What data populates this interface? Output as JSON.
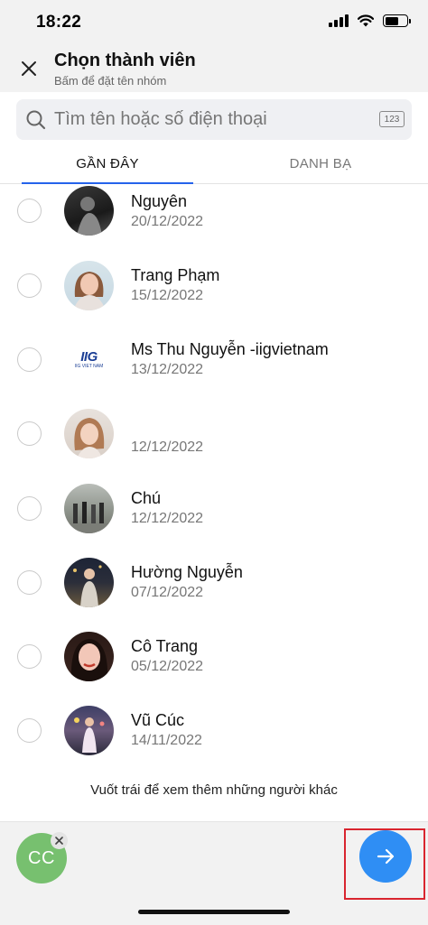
{
  "status_bar": {
    "time": "18:22",
    "icons": [
      "signal-icon",
      "wifi-icon",
      "battery-icon"
    ]
  },
  "header": {
    "close_icon": "close-icon",
    "title": "Chọn thành viên",
    "subtitle": "Bấm để đặt tên nhóm"
  },
  "search": {
    "placeholder": "Tìm tên hoặc số điện thoại",
    "value": "",
    "numpad_label": "123"
  },
  "tabs": [
    {
      "label": "GẦN ĐÂY",
      "active": true
    },
    {
      "label": "DANH BẠ",
      "active": false
    }
  ],
  "contacts": [
    {
      "name": "Nguyên",
      "date": "20/12/2022",
      "avatar": "photo-avatar"
    },
    {
      "name": "Trang Phạm",
      "date": "15/12/2022",
      "avatar": "photo-avatar"
    },
    {
      "name": "Ms Thu Nguyễn -iigvietnam",
      "date": "13/12/2022",
      "avatar": "iig-logo"
    },
    {
      "name": "",
      "date": "12/12/2022",
      "avatar": "photo-avatar"
    },
    {
      "name": "Chú",
      "date": "12/12/2022",
      "avatar": "photo-avatar"
    },
    {
      "name": "Hường Nguyễn",
      "date": "07/12/2022",
      "avatar": "photo-avatar"
    },
    {
      "name": "Cô Trang",
      "date": "05/12/2022",
      "avatar": "photo-avatar"
    },
    {
      "name": "Vũ Cúc",
      "date": "14/11/2022",
      "avatar": "photo-avatar"
    }
  ],
  "iig_logo": {
    "mark": "IIG",
    "caption": "IIG VIET NAM"
  },
  "hint": "Vuốt trái để xem thêm những người khác",
  "bottom": {
    "selected_initials": "CC",
    "selected_color": "#77c06f",
    "next_button_color": "#2f8ef4",
    "highlight_color": "#d9252f"
  }
}
